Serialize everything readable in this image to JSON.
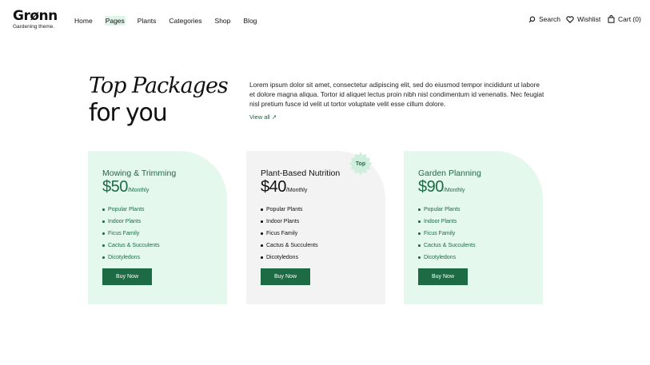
{
  "brand": {
    "name": "Grønn",
    "tagline": "Gardening theme."
  },
  "nav": {
    "items": [
      {
        "label": "Home"
      },
      {
        "label": "Pages"
      },
      {
        "label": "Plants"
      },
      {
        "label": "Categories"
      },
      {
        "label": "Shop"
      },
      {
        "label": "Blog"
      }
    ],
    "active": "Pages"
  },
  "utilities": {
    "search": "Search",
    "wishlist": "Wishlist",
    "cart": "Cart (0)"
  },
  "hero": {
    "title_line1": "Top Packages",
    "title_line2": "for you",
    "intro": "Lorem ipsum dolor sit amet, consectetur adipiscing elit, sed do eiusmod tempor incididunt ut labore et dolore magna aliqua. Tortor id aliquet lectus proin nibh nisl condimentum id venenatis. Nec feugiat nisl pretium fusce id velit ut tortor voluptate velit esse cillum dolore.",
    "view_all": "View all ↗"
  },
  "colors": {
    "accent": "#1c6b45",
    "mint": "#e4f8ee",
    "grey": "#f3f3f3",
    "nav_active": "#dff5ea"
  },
  "packages": [
    {
      "title": "Mowing & Trimming",
      "price": "$50",
      "period": "/Monthly",
      "features": [
        "Popular Plants",
        "Indoor Plants",
        "Ficus Family",
        "Cactus & Succulents",
        "Dicotyledons"
      ],
      "button": "Buy Now"
    },
    {
      "title": "Plant-Based Nutrition",
      "price": "$40",
      "period": "/Monthly",
      "badge": "Top",
      "features": [
        "Popular Plants",
        "Indoor Plants",
        "Ficus Family",
        "Cactus & Succulents",
        "Dicotyledons"
      ],
      "button": "Buy Now"
    },
    {
      "title": "Garden Planning",
      "price": "$90",
      "period": "/Monthly",
      "features": [
        "Popular Plants",
        "Indoor Plants",
        "Ficus Family",
        "Cactus & Succulents",
        "Dicotyledons"
      ],
      "button": "Buy Now"
    }
  ]
}
